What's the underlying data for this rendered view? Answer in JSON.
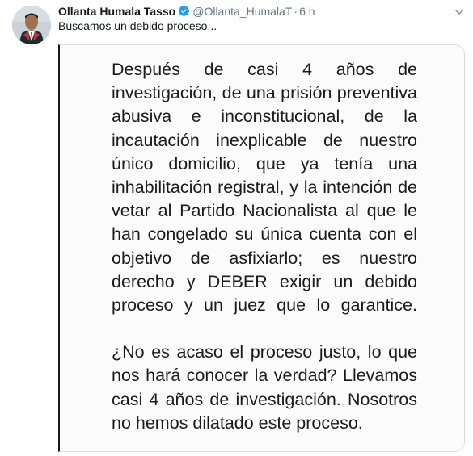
{
  "tweet": {
    "author_name": "Ollanta Humala Tasso",
    "handle": "@Ollanta_HumalaT",
    "separator": "·",
    "time": "6 h",
    "text": "Buscamos un debido proceso..."
  },
  "media": {
    "paragraphs": [
      "Después de casi 4 años de investigación, de una prisión preventiva abusiva e inconstitucional, de la incautación inexplicable de nuestro único domicilio, que ya tenía una inhabilitación registral, y la intención de vetar al Partido Nacionalista al que le han congelado su única cuenta con el objetivo de asfixiarlo; es nuestro derecho y DEBER exigir un debido proceso y un juez que lo garantice.",
      "¿No es acaso el proceso justo, lo que nos hará conocer la verdad? Llevamos casi 4 años de investigación. Nosotros no hemos dilatado este proceso."
    ]
  },
  "icons": {
    "verified": "verified-badge-icon",
    "caret": "chevron-down-icon"
  },
  "colors": {
    "verified_blue": "#1da1f2",
    "muted_text": "#657786",
    "primary_text": "#14171a"
  }
}
